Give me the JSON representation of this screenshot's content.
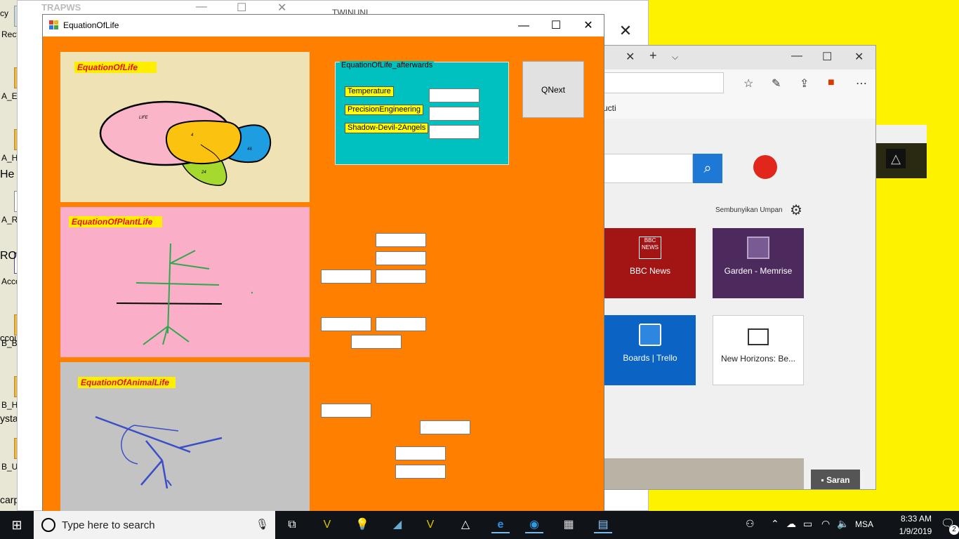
{
  "desktop": {
    "icons": [
      {
        "label": "Recycle Bi"
      },
      {
        "label": "A_EquipFa"
      },
      {
        "label": "A_Hereito"
      },
      {
        "label": "A_ROKMA"
      },
      {
        "label": "Account"
      },
      {
        "label": "B_Business"
      },
      {
        "label": "B_Handker"
      },
      {
        "label": "B_UTAxle"
      }
    ],
    "bg_window_title": "TRAPWS",
    "bg_window_text": "TWINUNI",
    "partial_texts": [
      "cy",
      "He",
      "RO",
      "ccount:",
      "ystand:",
      "carpet?"
    ]
  },
  "browser": {
    "favbar_text": "ucti",
    "hide_feed": "Sembunyikan Umpan",
    "tiles": [
      {
        "label": "BBC News",
        "icon": "bbc-news-icon",
        "icon_text": "BBC NEWS"
      },
      {
        "label": "Garden - Memrise",
        "icon": "memrise-icon"
      },
      {
        "label": "Boards | Trello",
        "icon": "trello-icon"
      },
      {
        "label": "New Horizons: Be...",
        "icon": "window-icon"
      }
    ],
    "saran": "Saran"
  },
  "app": {
    "title": "EquationOfLife",
    "panels": {
      "life": {
        "label": "EquationOfLife",
        "venn": {
          "big_label": "LIFE",
          "overlap": "4",
          "blue": "46",
          "green": "24"
        }
      },
      "plant": {
        "label": "EquationOfPlantLife"
      },
      "animal": {
        "label": "EquationOfAnimalLife"
      }
    },
    "group": {
      "title": "EquationOfLife_afterwards",
      "rows": [
        {
          "label": "Temperature",
          "value": ""
        },
        {
          "label": "PrecisionEngineering",
          "value": ""
        },
        {
          "label": "Shadow-Devil-2Angels",
          "value": ""
        }
      ]
    },
    "qnext_label": "QNext"
  },
  "taskbar": {
    "search_placeholder": "Type here to search",
    "language": "MSA",
    "time": "8:33 AM",
    "date": "1/9/2019",
    "notification_count": "2"
  },
  "colors": {
    "app_bg": "#ff8000",
    "life_panel": "#efe3b6",
    "plant_panel": "#fbaec8",
    "animal_panel": "#c3c3c3",
    "group_box": "#00c0c0",
    "label_yellow": "#ffee00",
    "label_red": "#e61010",
    "desktop_yellow": "#fdf200",
    "taskbar": "#101419"
  }
}
